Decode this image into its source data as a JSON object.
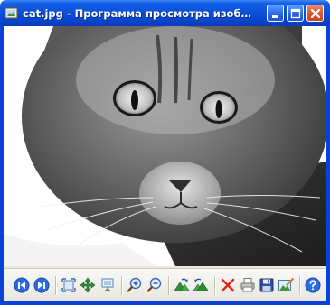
{
  "window": {
    "title": "cat.jpg - Программа просмотра изображений...",
    "colors": {
      "titlebar": "#0a4fd6",
      "frame": "#0842d8",
      "close": "#d9542b",
      "toolbar": "#ece9d8"
    }
  },
  "titlebar_buttons": [
    {
      "name": "minimize-button",
      "icon": "minimize-icon"
    },
    {
      "name": "maximize-button",
      "icon": "maximize-icon"
    },
    {
      "name": "close-button",
      "icon": "close-icon"
    }
  ],
  "image": {
    "subject": "cat",
    "style": "black-and-white photo"
  },
  "toolbar": {
    "buttons": [
      {
        "name": "previous-image-button",
        "icon": "previous-icon"
      },
      {
        "name": "next-image-button",
        "icon": "next-icon"
      },
      {
        "name": "best-fit-button",
        "icon": "best-fit-icon"
      },
      {
        "name": "actual-size-button",
        "icon": "actual-size-icon"
      },
      {
        "name": "slideshow-button",
        "icon": "slideshow-icon"
      },
      {
        "name": "zoom-in-button",
        "icon": "zoom-in-icon"
      },
      {
        "name": "zoom-out-button",
        "icon": "zoom-out-icon"
      },
      {
        "name": "rotate-clockwise-button",
        "icon": "rotate-clockwise-icon"
      },
      {
        "name": "rotate-counterclockwise-button",
        "icon": "rotate-counterclockwise-icon"
      },
      {
        "name": "delete-button",
        "icon": "delete-icon"
      },
      {
        "name": "print-button",
        "icon": "print-icon"
      },
      {
        "name": "save-copy-button",
        "icon": "save-icon"
      },
      {
        "name": "open-editor-button",
        "icon": "edit-icon"
      },
      {
        "name": "help-button",
        "icon": "help-icon"
      }
    ]
  }
}
